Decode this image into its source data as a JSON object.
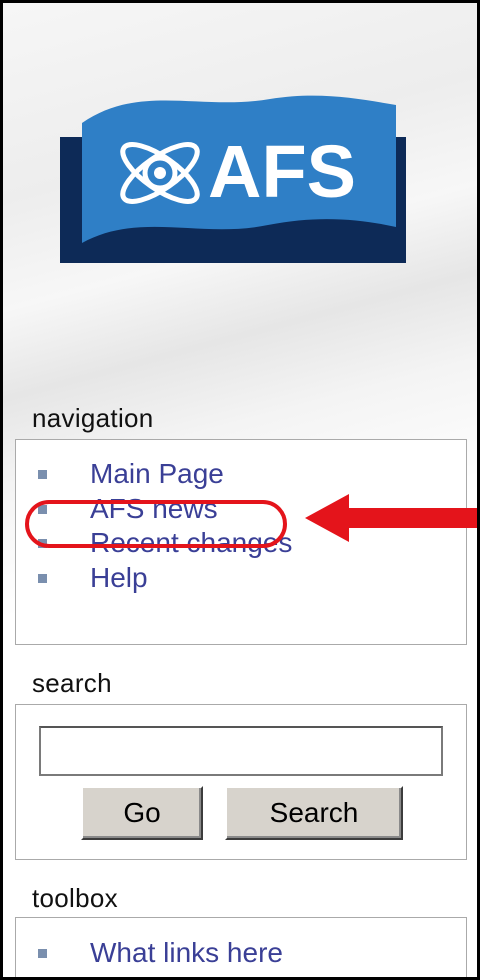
{
  "logo": {
    "text": "AFS"
  },
  "navigation": {
    "title": "navigation",
    "items": [
      {
        "label": "Main Page"
      },
      {
        "label": "AFS news"
      },
      {
        "label": "Recent changes"
      },
      {
        "label": "Help"
      }
    ]
  },
  "search": {
    "title": "search",
    "input_value": "",
    "go_label": "Go",
    "search_label": "Search"
  },
  "toolbox": {
    "title": "toolbox",
    "items": [
      {
        "label": "What links here"
      }
    ]
  },
  "annotation": {
    "color": "#e4141b",
    "highlighted_item": "AFS news"
  },
  "colors": {
    "link": "#3a3f96",
    "bullet": "#7a8fae",
    "logo_flag": "#2f7fc6",
    "logo_bg": "#0d2a57"
  }
}
